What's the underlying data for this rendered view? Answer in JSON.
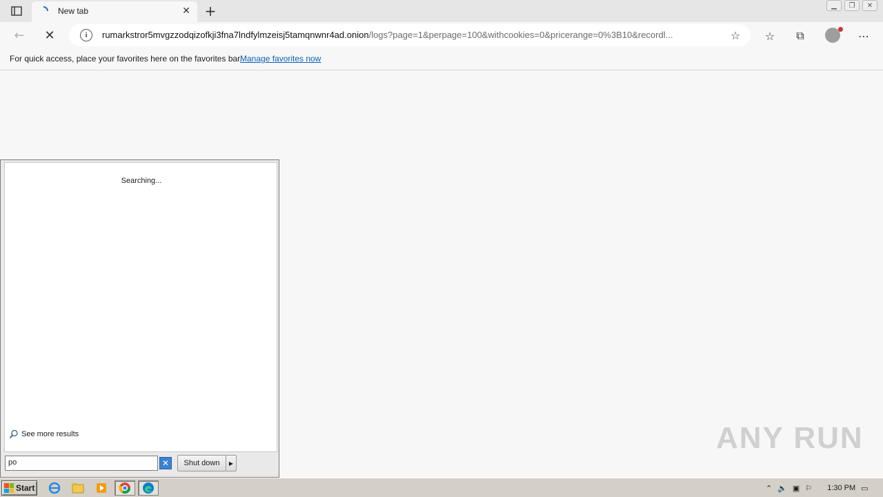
{
  "browser": {
    "tab_title": "New tab",
    "url_host": "rumarkstror5mvgzzodqizofkji3fna7lndfylmzeisj5tamqnwnr4ad.onion",
    "url_path": "/logs?page=1&perpage=100&withcookies=0&pricerange=0%3B10&recordl...",
    "favbar_message": "For quick access, place your favorites here on the favorites bar.",
    "favbar_link": "Manage favorites now"
  },
  "start_menu": {
    "status_text": "Searching...",
    "see_more": "See more results",
    "search_value": "po",
    "shutdown_label": "Shut down"
  },
  "taskbar": {
    "start_label": "Start",
    "clock": "1:30 PM"
  },
  "watermark": "ANY RUN",
  "colors": {
    "link": "#0a5fb4",
    "taskbar": "#d4d0c8",
    "clear_button": "#3b82d4"
  }
}
